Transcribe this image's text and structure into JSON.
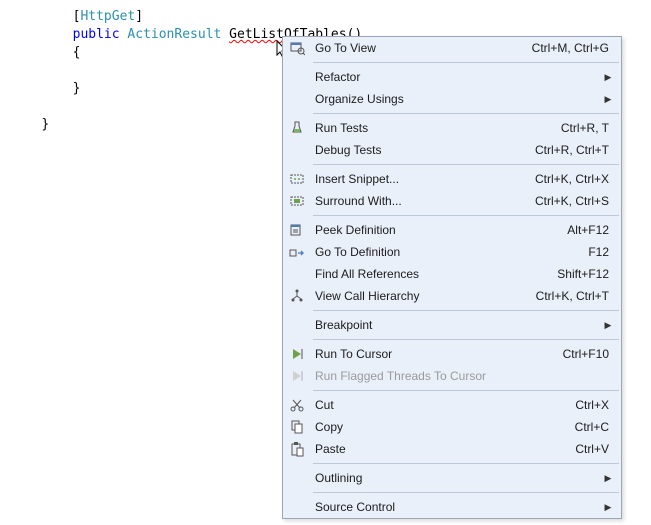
{
  "code": {
    "attr_open": "[",
    "attr_name": "HttpGet",
    "attr_close": "]",
    "kw_public": "public",
    "type_result": "ActionResult",
    "method_name": "GetListOfTables",
    "parens": "()",
    "brace_open": "{",
    "brace_close": "}"
  },
  "menu": {
    "items": [
      {
        "label": "Go To View",
        "shortcut": "Ctrl+M, Ctrl+G",
        "icon": "goto-view-icon",
        "sep_after": true
      },
      {
        "label": "Refactor",
        "submenu": true
      },
      {
        "label": "Organize Usings",
        "submenu": true,
        "sep_after": true
      },
      {
        "label": "Run Tests",
        "shortcut": "Ctrl+R, T",
        "icon": "run-tests-icon"
      },
      {
        "label": "Debug Tests",
        "shortcut": "Ctrl+R, Ctrl+T",
        "sep_after": true
      },
      {
        "label": "Insert Snippet...",
        "shortcut": "Ctrl+K, Ctrl+X",
        "icon": "snippet-icon"
      },
      {
        "label": "Surround With...",
        "shortcut": "Ctrl+K, Ctrl+S",
        "icon": "surround-icon",
        "sep_after": true
      },
      {
        "label": "Peek Definition",
        "shortcut": "Alt+F12",
        "icon": "peek-icon"
      },
      {
        "label": "Go To Definition",
        "shortcut": "F12",
        "icon": "goto-def-icon"
      },
      {
        "label": "Find All References",
        "shortcut": "Shift+F12"
      },
      {
        "label": "View Call Hierarchy",
        "shortcut": "Ctrl+K, Ctrl+T",
        "icon": "hierarchy-icon",
        "sep_after": true
      },
      {
        "label": "Breakpoint",
        "submenu": true,
        "sep_after": true
      },
      {
        "label": "Run To Cursor",
        "shortcut": "Ctrl+F10",
        "icon": "run-cursor-icon"
      },
      {
        "label": "Run Flagged Threads To Cursor",
        "icon": "run-flagged-icon",
        "disabled": true,
        "sep_after": true
      },
      {
        "label": "Cut",
        "shortcut": "Ctrl+X",
        "icon": "cut-icon"
      },
      {
        "label": "Copy",
        "shortcut": "Ctrl+C",
        "icon": "copy-icon"
      },
      {
        "label": "Paste",
        "shortcut": "Ctrl+V",
        "icon": "paste-icon",
        "sep_after": true
      },
      {
        "label": "Outlining",
        "submenu": true,
        "sep_after": true
      },
      {
        "label": "Source Control",
        "submenu": true
      }
    ]
  }
}
